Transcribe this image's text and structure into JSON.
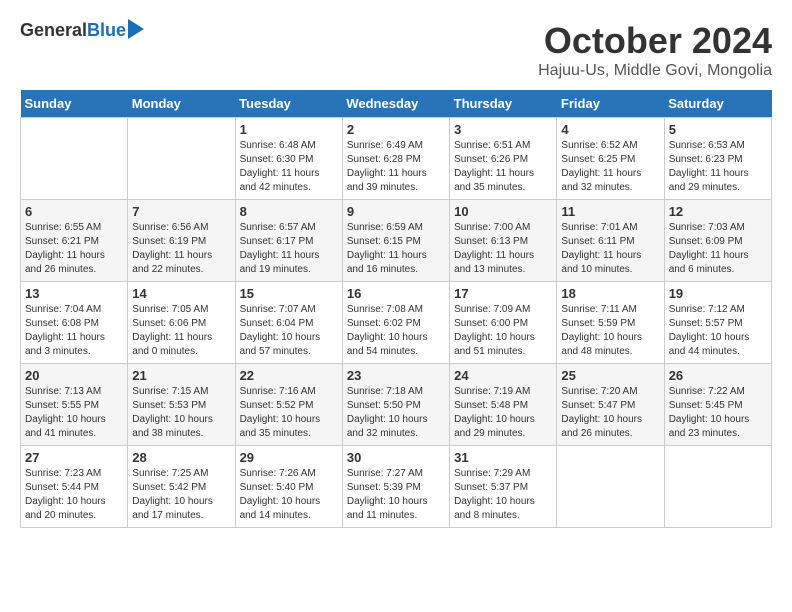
{
  "logo": {
    "general": "General",
    "blue": "Blue"
  },
  "title": "October 2024",
  "subtitle": "Hajuu-Us, Middle Govi, Mongolia",
  "days_header": [
    "Sunday",
    "Monday",
    "Tuesday",
    "Wednesday",
    "Thursday",
    "Friday",
    "Saturday"
  ],
  "weeks": [
    [
      {
        "day": "",
        "info": ""
      },
      {
        "day": "",
        "info": ""
      },
      {
        "day": "1",
        "info": "Sunrise: 6:48 AM\nSunset: 6:30 PM\nDaylight: 11 hours and 42 minutes."
      },
      {
        "day": "2",
        "info": "Sunrise: 6:49 AM\nSunset: 6:28 PM\nDaylight: 11 hours and 39 minutes."
      },
      {
        "day": "3",
        "info": "Sunrise: 6:51 AM\nSunset: 6:26 PM\nDaylight: 11 hours and 35 minutes."
      },
      {
        "day": "4",
        "info": "Sunrise: 6:52 AM\nSunset: 6:25 PM\nDaylight: 11 hours and 32 minutes."
      },
      {
        "day": "5",
        "info": "Sunrise: 6:53 AM\nSunset: 6:23 PM\nDaylight: 11 hours and 29 minutes."
      }
    ],
    [
      {
        "day": "6",
        "info": "Sunrise: 6:55 AM\nSunset: 6:21 PM\nDaylight: 11 hours and 26 minutes."
      },
      {
        "day": "7",
        "info": "Sunrise: 6:56 AM\nSunset: 6:19 PM\nDaylight: 11 hours and 22 minutes."
      },
      {
        "day": "8",
        "info": "Sunrise: 6:57 AM\nSunset: 6:17 PM\nDaylight: 11 hours and 19 minutes."
      },
      {
        "day": "9",
        "info": "Sunrise: 6:59 AM\nSunset: 6:15 PM\nDaylight: 11 hours and 16 minutes."
      },
      {
        "day": "10",
        "info": "Sunrise: 7:00 AM\nSunset: 6:13 PM\nDaylight: 11 hours and 13 minutes."
      },
      {
        "day": "11",
        "info": "Sunrise: 7:01 AM\nSunset: 6:11 PM\nDaylight: 11 hours and 10 minutes."
      },
      {
        "day": "12",
        "info": "Sunrise: 7:03 AM\nSunset: 6:09 PM\nDaylight: 11 hours and 6 minutes."
      }
    ],
    [
      {
        "day": "13",
        "info": "Sunrise: 7:04 AM\nSunset: 6:08 PM\nDaylight: 11 hours and 3 minutes."
      },
      {
        "day": "14",
        "info": "Sunrise: 7:05 AM\nSunset: 6:06 PM\nDaylight: 11 hours and 0 minutes."
      },
      {
        "day": "15",
        "info": "Sunrise: 7:07 AM\nSunset: 6:04 PM\nDaylight: 10 hours and 57 minutes."
      },
      {
        "day": "16",
        "info": "Sunrise: 7:08 AM\nSunset: 6:02 PM\nDaylight: 10 hours and 54 minutes."
      },
      {
        "day": "17",
        "info": "Sunrise: 7:09 AM\nSunset: 6:00 PM\nDaylight: 10 hours and 51 minutes."
      },
      {
        "day": "18",
        "info": "Sunrise: 7:11 AM\nSunset: 5:59 PM\nDaylight: 10 hours and 48 minutes."
      },
      {
        "day": "19",
        "info": "Sunrise: 7:12 AM\nSunset: 5:57 PM\nDaylight: 10 hours and 44 minutes."
      }
    ],
    [
      {
        "day": "20",
        "info": "Sunrise: 7:13 AM\nSunset: 5:55 PM\nDaylight: 10 hours and 41 minutes."
      },
      {
        "day": "21",
        "info": "Sunrise: 7:15 AM\nSunset: 5:53 PM\nDaylight: 10 hours and 38 minutes."
      },
      {
        "day": "22",
        "info": "Sunrise: 7:16 AM\nSunset: 5:52 PM\nDaylight: 10 hours and 35 minutes."
      },
      {
        "day": "23",
        "info": "Sunrise: 7:18 AM\nSunset: 5:50 PM\nDaylight: 10 hours and 32 minutes."
      },
      {
        "day": "24",
        "info": "Sunrise: 7:19 AM\nSunset: 5:48 PM\nDaylight: 10 hours and 29 minutes."
      },
      {
        "day": "25",
        "info": "Sunrise: 7:20 AM\nSunset: 5:47 PM\nDaylight: 10 hours and 26 minutes."
      },
      {
        "day": "26",
        "info": "Sunrise: 7:22 AM\nSunset: 5:45 PM\nDaylight: 10 hours and 23 minutes."
      }
    ],
    [
      {
        "day": "27",
        "info": "Sunrise: 7:23 AM\nSunset: 5:44 PM\nDaylight: 10 hours and 20 minutes."
      },
      {
        "day": "28",
        "info": "Sunrise: 7:25 AM\nSunset: 5:42 PM\nDaylight: 10 hours and 17 minutes."
      },
      {
        "day": "29",
        "info": "Sunrise: 7:26 AM\nSunset: 5:40 PM\nDaylight: 10 hours and 14 minutes."
      },
      {
        "day": "30",
        "info": "Sunrise: 7:27 AM\nSunset: 5:39 PM\nDaylight: 10 hours and 11 minutes."
      },
      {
        "day": "31",
        "info": "Sunrise: 7:29 AM\nSunset: 5:37 PM\nDaylight: 10 hours and 8 minutes."
      },
      {
        "day": "",
        "info": ""
      },
      {
        "day": "",
        "info": ""
      }
    ]
  ]
}
